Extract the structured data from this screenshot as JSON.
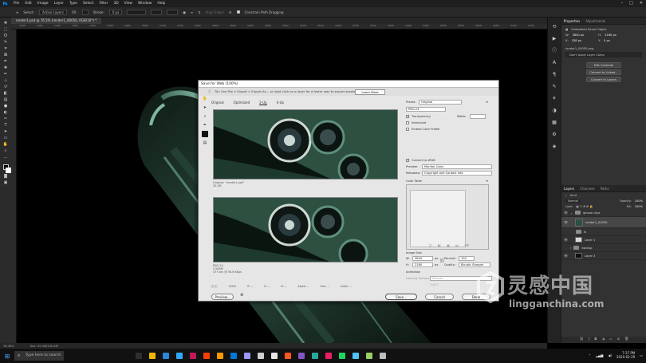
{
  "menubar": {
    "logo": "Ps",
    "items": [
      "File",
      "Edit",
      "Image",
      "Layer",
      "Type",
      "Select",
      "Filter",
      "3D",
      "View",
      "Window",
      "Help"
    ]
  },
  "options": {
    "select_label": "Select:",
    "select_value": "Active Layers",
    "fill_label": "Fill:",
    "stroke_label": "Stroke:",
    "stroke_value": "0 px",
    "align_edges": "Align Edges",
    "constrain": "Constrain Path Dragging"
  },
  "document": {
    "tab": "render1.psd @ 76.5% (render1_00050, RGB/16*) *",
    "ruler_ticks": [
      "1300",
      "1350",
      "1400",
      "1450",
      "1500",
      "1550",
      "1600",
      "1650",
      "1700",
      "1750",
      "1800",
      "1850",
      "1900",
      "1950",
      "2000",
      "2050",
      "2100",
      "2150",
      "2200",
      "2250",
      "2300",
      "2350",
      "2400",
      "2450",
      "2500",
      "2550",
      "2600",
      "2650",
      "2700",
      "2750",
      "2800"
    ]
  },
  "status": {
    "zoom": "76.49%",
    "doc": "Doc: 32.2M/195.4M"
  },
  "dialog": {
    "title": "Save for Web (100%)",
    "tip": "Tip: Use File > Export > Export As...  or right click on a layer for a faster way to export assets",
    "learn_more": "Learn More",
    "tabs": [
      "Original",
      "Optimized",
      "2-Up",
      "4-Up"
    ],
    "original_info": [
      "Original: \"render1.psd\"",
      "32.2M"
    ],
    "optimized_info": [
      "PNG-24",
      "3.548M",
      "477 sec @ 56.6 Kbps"
    ],
    "preset_label": "Preset:",
    "preset_value": "Original",
    "format_value": "PNG-24",
    "transparency": "Transparency",
    "matte_label": "Matte:",
    "interlaced": "Interlaced",
    "embed_profile": "Embed Color Profile",
    "convert_srgb": "Convert to sRGB",
    "preview_label": "Preview:",
    "preview_value": "Monitor Color",
    "metadata_label": "Metadata:",
    "metadata_value": "Copyright and Contact Info",
    "color_table": "Color Table",
    "image_size": "Image Size",
    "w_label": "W:",
    "w_value": "3840",
    "h_label": "H:",
    "h_value": "2160",
    "px": "px",
    "percent_label": "Percent:",
    "percent_value": "100",
    "quality_label": "Quality:",
    "quality_value": "Bicubic Sharper",
    "animation": "Animation",
    "looping_label": "Looping Options:",
    "looping_value": "Forever",
    "zoom_value": "100%",
    "readouts": [
      "R: --",
      "G: --",
      "B: --",
      "Alpha: --",
      "Hex: --",
      "Index: --"
    ],
    "frames": "1 of 1",
    "preview_btn": "Preview...",
    "save_btn": "Save...",
    "cancel_btn": "Cancel",
    "done_btn": "Done"
  },
  "properties": {
    "tabs": [
      "Properties",
      "Adjustments"
    ],
    "section": "Embedded Smart Object",
    "w_label": "W:",
    "w_value": "3840 px",
    "h_label": "H:",
    "h_value": "2160 px",
    "x_label": "X:",
    "x_value": "338 px",
    "y_label": "Y:",
    "y_value": "0 px",
    "file": "render1_00050.png",
    "comps": "Don't Apply Layer Comp",
    "edit_contents": "Edit Contents",
    "convert_linked": "Convert to Linked...",
    "convert_layers": "Convert to Layers"
  },
  "layers": {
    "tabs": [
      "Layers",
      "Channels",
      "Paths"
    ],
    "kind": "Kind",
    "blend": "Normal",
    "opacity_label": "Opacity:",
    "opacity": "100%",
    "lock_label": "Lock:",
    "fill_label": "Fill:",
    "fill": "100%",
    "items": [
      {
        "name": "iphone clips",
        "type": "folder"
      },
      {
        "name": "render1_00050",
        "type": "smart",
        "selected": true
      },
      {
        "name": "fx",
        "type": "fx"
      },
      {
        "name": "Layer 1",
        "type": "white"
      },
      {
        "name": "backup",
        "type": "folder"
      },
      {
        "name": "Layer 3",
        "type": "black"
      }
    ]
  },
  "taskbar": {
    "search": "Type here to search",
    "time": "7:37 PM",
    "date": "2020-02-29",
    "app_colors": [
      "#2f2f2f",
      "#f2b705",
      "#2b88d8",
      "#31a8ff",
      "#c2185b",
      "#ff3d00",
      "#ff9a00",
      "#0078d4",
      "#9999ff",
      "#d0d0d0",
      "#e6e6e6",
      "#ff5722",
      "#7e57c2",
      "#26a69a",
      "#e91e63",
      "#1ed760",
      "#4fc3f7",
      "#9ccc65",
      "#bdbdbd"
    ]
  },
  "watermark": {
    "cn": "灵感中国",
    "en": "lingganchina.com"
  }
}
